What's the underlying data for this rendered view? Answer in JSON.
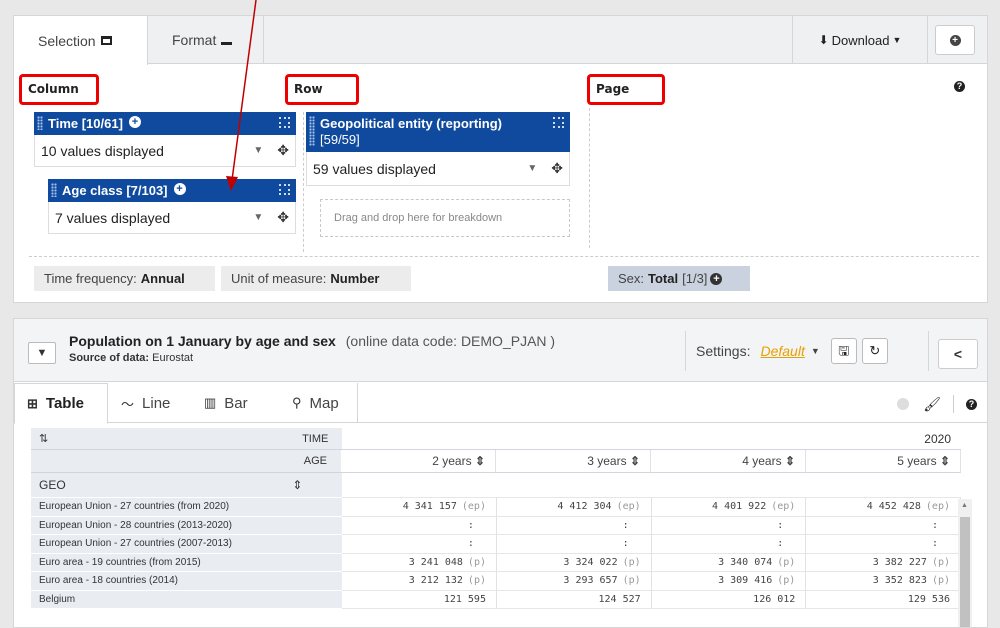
{
  "top_tabs": {
    "selection": "Selection",
    "format": "Format"
  },
  "download_label": "Download",
  "zones": {
    "column": "Column",
    "row": "Row",
    "page": "Page"
  },
  "dimensions": {
    "time": {
      "title": "Time [10/61]",
      "value": "10 values displayed"
    },
    "age": {
      "title": "Age class [7/103]",
      "value": "7 values displayed"
    },
    "geo": {
      "title_line1": "Geopolitical entity (reporting)",
      "title_line2": "[59/59]",
      "value": "59 values displayed"
    }
  },
  "drop_hint": "Drag and drop here for breakdown",
  "fixed": {
    "freq_label": "Time frequency:",
    "freq_value": "Annual",
    "unit_label": "Unit of measure:",
    "unit_value": "Number",
    "sex_label": "Sex:",
    "sex_value": "Total",
    "sex_count": "[1/3]"
  },
  "dataset": {
    "title": "Population on 1 January by age and sex",
    "code": "(online data code: DEMO_PJAN )",
    "source_label": "Source of data:",
    "source_value": "Eurostat",
    "settings_label": "Settings:",
    "settings_value": "Default"
  },
  "view_tabs": {
    "table": "Table",
    "line": "Line",
    "bar": "Bar",
    "map": "Map"
  },
  "table": {
    "time_label": "TIME",
    "time_value": "2020",
    "age_label": "AGE",
    "geo_label": "GEO",
    "age_columns": [
      "2 years",
      "3 years",
      "4 years",
      "5 years"
    ],
    "rows": [
      {
        "geo": "European Union - 27 countries (from 2020)",
        "cells": [
          {
            "v": "4 341 157",
            "f": "(ep)"
          },
          {
            "v": "4 412 304",
            "f": "(ep)"
          },
          {
            "v": "4 401 922",
            "f": "(ep)"
          },
          {
            "v": "4 452 428",
            "f": "(ep)"
          }
        ]
      },
      {
        "geo": "European Union - 28 countries (2013-2020)",
        "cells": [
          {
            "v": ":",
            "f": ""
          },
          {
            "v": ":",
            "f": ""
          },
          {
            "v": ":",
            "f": ""
          },
          {
            "v": ":",
            "f": ""
          }
        ]
      },
      {
        "geo": "European Union - 27 countries (2007-2013)",
        "cells": [
          {
            "v": ":",
            "f": ""
          },
          {
            "v": ":",
            "f": ""
          },
          {
            "v": ":",
            "f": ""
          },
          {
            "v": ":",
            "f": ""
          }
        ]
      },
      {
        "geo": "Euro area - 19 countries (from 2015)",
        "cells": [
          {
            "v": "3 241 048",
            "f": "(p)"
          },
          {
            "v": "3 324 022",
            "f": "(p)"
          },
          {
            "v": "3 340 074",
            "f": "(p)"
          },
          {
            "v": "3 382 227",
            "f": "(p)"
          }
        ]
      },
      {
        "geo": "Euro area - 18 countries (2014)",
        "cells": [
          {
            "v": "3 212 132",
            "f": "(p)"
          },
          {
            "v": "3 293 657",
            "f": "(p)"
          },
          {
            "v": "3 309 416",
            "f": "(p)"
          },
          {
            "v": "3 352 823",
            "f": "(p)"
          }
        ]
      },
      {
        "geo": "Belgium",
        "cells": [
          {
            "v": "121 595",
            "f": ""
          },
          {
            "v": "124 527",
            "f": ""
          },
          {
            "v": "126 012",
            "f": ""
          },
          {
            "v": "129 536",
            "f": ""
          }
        ]
      }
    ]
  },
  "colors": {
    "dim_header": "#0f4a9e",
    "annotation": "#ee0000",
    "settings_default": "#e8a000"
  }
}
